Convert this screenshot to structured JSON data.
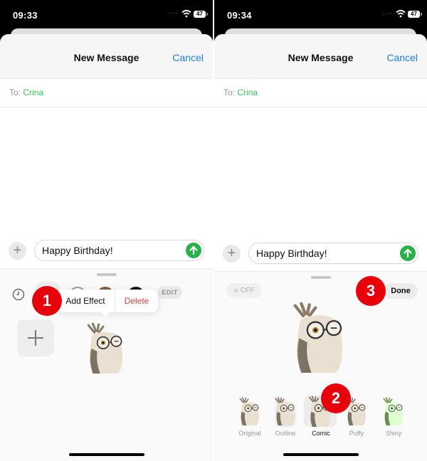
{
  "screens": [
    {
      "status": {
        "time": "09:33",
        "battery": "47"
      },
      "header": {
        "title": "New Message",
        "cancel_label": "Cancel"
      },
      "recipient": {
        "label": "To:",
        "name": "Crina"
      },
      "compose": {
        "message_text": "Happy Birthday!"
      },
      "tray": {
        "edit_label": "EDIT"
      },
      "context_menu": {
        "add_effect_label": "Add Effect",
        "delete_label": "Delete"
      },
      "step_badge": "1"
    },
    {
      "status": {
        "time": "09:34",
        "battery": "47"
      },
      "header": {
        "title": "New Message",
        "cancel_label": "Cancel"
      },
      "recipient": {
        "label": "To:",
        "name": "Crina"
      },
      "compose": {
        "message_text": "Happy Birthday!"
      },
      "effects_editor": {
        "animation_toggle_label": "OFF",
        "done_label": "Done",
        "selected_effect": "Comic",
        "effects": [
          {
            "label": "Original"
          },
          {
            "label": "Outline"
          },
          {
            "label": "Comic"
          },
          {
            "label": "Puffy"
          },
          {
            "label": "Shiny"
          }
        ]
      },
      "step_badges": [
        "2",
        "3"
      ]
    }
  ],
  "colors": {
    "accent_blue": "#1a7fe6",
    "recipient_green": "#34c759",
    "send_green": "#2ab24a",
    "delete_red": "#ea3d3d",
    "badge_red": "#e8000b"
  }
}
